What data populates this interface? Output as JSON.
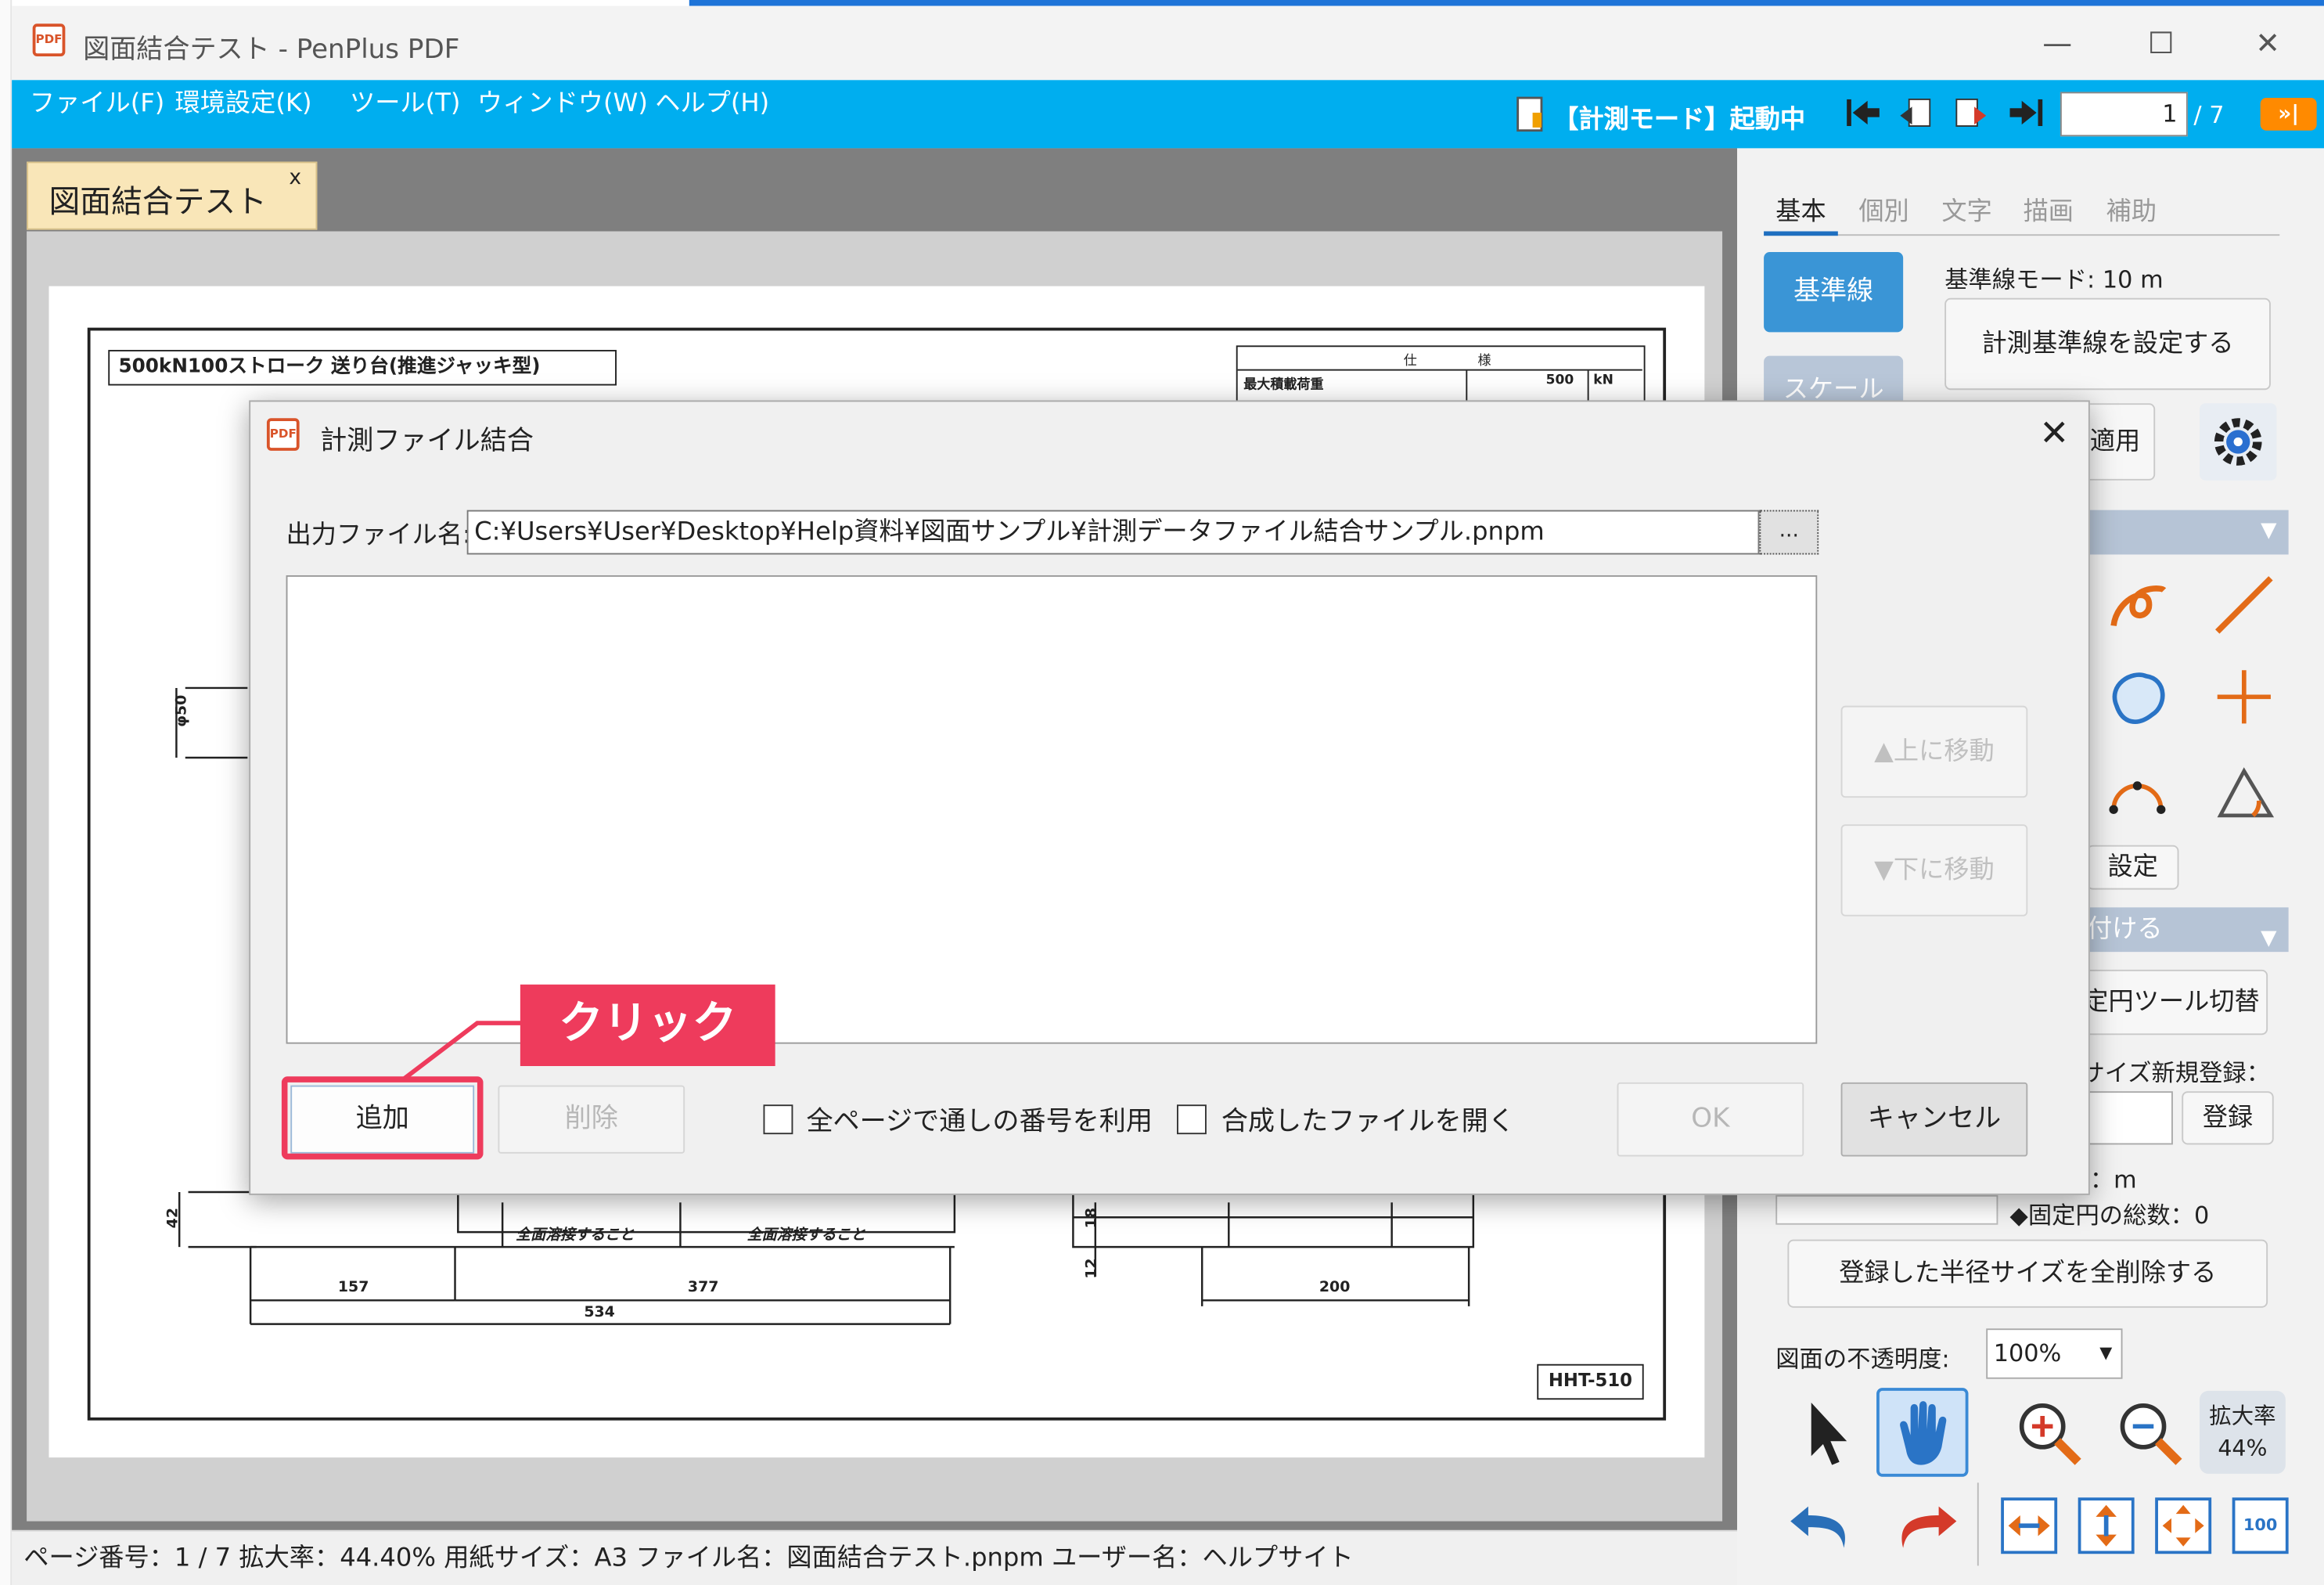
{
  "window": {
    "title": "図面結合テスト - PenPlus PDF",
    "app_icon": "PDF"
  },
  "menu": {
    "items": [
      "ファイル(F)",
      "環境設定(K)",
      "ツール(T)",
      "ウィンドウ(W)",
      "ヘルプ(H)"
    ],
    "mode_status": "【計測モード】起動中",
    "page_current": "1",
    "page_total": "/ 7"
  },
  "doc_tab": {
    "label": "図面結合テスト",
    "close": "x"
  },
  "drawing": {
    "title": "500kN100ストローク 送り台(推進ジャッキ型)",
    "spec_header_left": "仕",
    "spec_header_right": "様",
    "spec_row_label": "最大積載荷重",
    "spec_row_value": "500",
    "spec_row_unit": "kN",
    "dim_phi": "φ50",
    "dim_42": "42",
    "dim_18": "18",
    "dim_12": "12",
    "dim_157": "157",
    "dim_377": "377",
    "dim_534": "534",
    "dim_200": "200",
    "note1": "全面溶接すること",
    "note2": "全面溶接すること",
    "code": "HHT-510"
  },
  "panel": {
    "tabs": [
      "基本",
      "個別",
      "文字",
      "描画",
      "補助"
    ],
    "baseline_button": "基準線",
    "scale_button": "スケール",
    "baseline_mode": "基準線モード: 10 m",
    "set_baseline": "計測基準線を設定する",
    "apply": "適用",
    "settings": "設定",
    "section2": "付ける",
    "circle_tool": "定円ツール切替",
    "size_register": "サイズ新規登録：",
    "register": "登録",
    "unit_m": "：m",
    "fixed_count": "◆固定円の総数：0",
    "delete_all": "登録した半径サイズを全削除する",
    "opacity_label": "図面の不透明度:",
    "opacity_value": "100%",
    "zoom_label": "拡大率",
    "zoom_value": "44%"
  },
  "dialog": {
    "title": "計測ファイル結合",
    "output_label": "出力ファイル名:",
    "output_value": "C:¥Users¥User¥Desktop¥Help資料¥図面サンプル¥計測データファイル結合サンプル.pnpm",
    "browse": "...",
    "move_up": "▲上に移動",
    "move_down": "▼下に移動",
    "add": "追加",
    "delete": "削除",
    "check_serial": "全ページで通しの番号を利用",
    "check_open": "合成したファイルを開く",
    "ok": "OK",
    "cancel": "キャンセル",
    "callout": "クリック"
  },
  "status": {
    "text": "ページ番号：1 / 7  拡大率：44.40%  用紙サイズ：A3  ファイル名：図面結合テスト.pnpm  ユーザー名：ヘルプサイト"
  }
}
